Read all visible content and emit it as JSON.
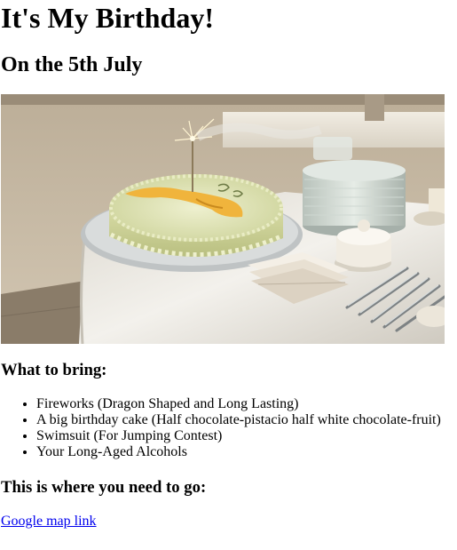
{
  "header": {
    "title": "It's My Birthday!",
    "date": "On the 5th July"
  },
  "photo": {
    "subject": "birthday cake with sparkler on a table with plates and cutlery",
    "colors": {
      "wall": "#c9bda9",
      "tablecloth": "#e8e6df",
      "cake_frosting": "#dfe3b6",
      "cake_decoration": "#f0b43c"
    }
  },
  "bring": {
    "heading": "What to bring:",
    "items": [
      "Fireworks (Dragon Shaped and Long Lasting)",
      "A big birthday cake (Half chocolate-pistacio half white chocolate-fruit)",
      "Swimsuit (For Jumping Contest)",
      "Your Long-Aged Alcohols"
    ]
  },
  "location": {
    "heading": "This is where you need to go:",
    "link_text": "Google map link",
    "link_color": "#0000ee"
  }
}
